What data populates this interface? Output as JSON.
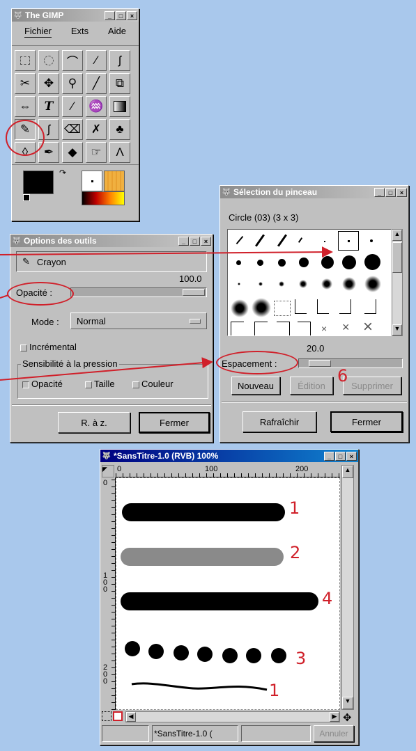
{
  "toolbox": {
    "title": "The GIMP",
    "menu": [
      "Fichier",
      "Exts",
      "Aide"
    ]
  },
  "tool_options": {
    "title": "Options des outils",
    "tool_name": "Crayon",
    "opacity_value": "100.0",
    "opacity_label": "Opacité :",
    "mode_label": "Mode :",
    "mode_value": "Normal",
    "incremental_label": "Incrémental",
    "pressure_group_label": "Sensibilité à la pression",
    "pressure_opacity": "Opacité",
    "pressure_size": "Taille",
    "pressure_color": "Couleur",
    "reset_label": "R. à z.",
    "close_label": "Fermer"
  },
  "brush_selection": {
    "title": "Sélection du pinceau",
    "brush_name": "Circle (03)  (3 x 3)",
    "spacing_value": "20.0",
    "spacing_label": "Espacement :",
    "new_label": "Nouveau",
    "edit_label": "Édition",
    "delete_label": "Supprimer",
    "refresh_label": "Rafraîchir",
    "close_label": "Fermer"
  },
  "image_window": {
    "title": "*SansTitre-1.0 (RVB) 100%",
    "ruler_h": [
      "0",
      "100",
      "200"
    ],
    "ruler_v": [
      "0",
      "1 0 0",
      "2 0 0"
    ],
    "status_name": "*SansTitre-1.0 (",
    "cancel_label": "Annuler"
  },
  "annotations": {
    "stroke1": "1",
    "stroke2": "2",
    "stroke3": "4",
    "stroke4": "3",
    "stroke5": "1",
    "spacing_number": "6"
  },
  "colors": {
    "desktop": "#a9c8ec",
    "annotation": "#d0202a",
    "active_title": "#000080"
  }
}
